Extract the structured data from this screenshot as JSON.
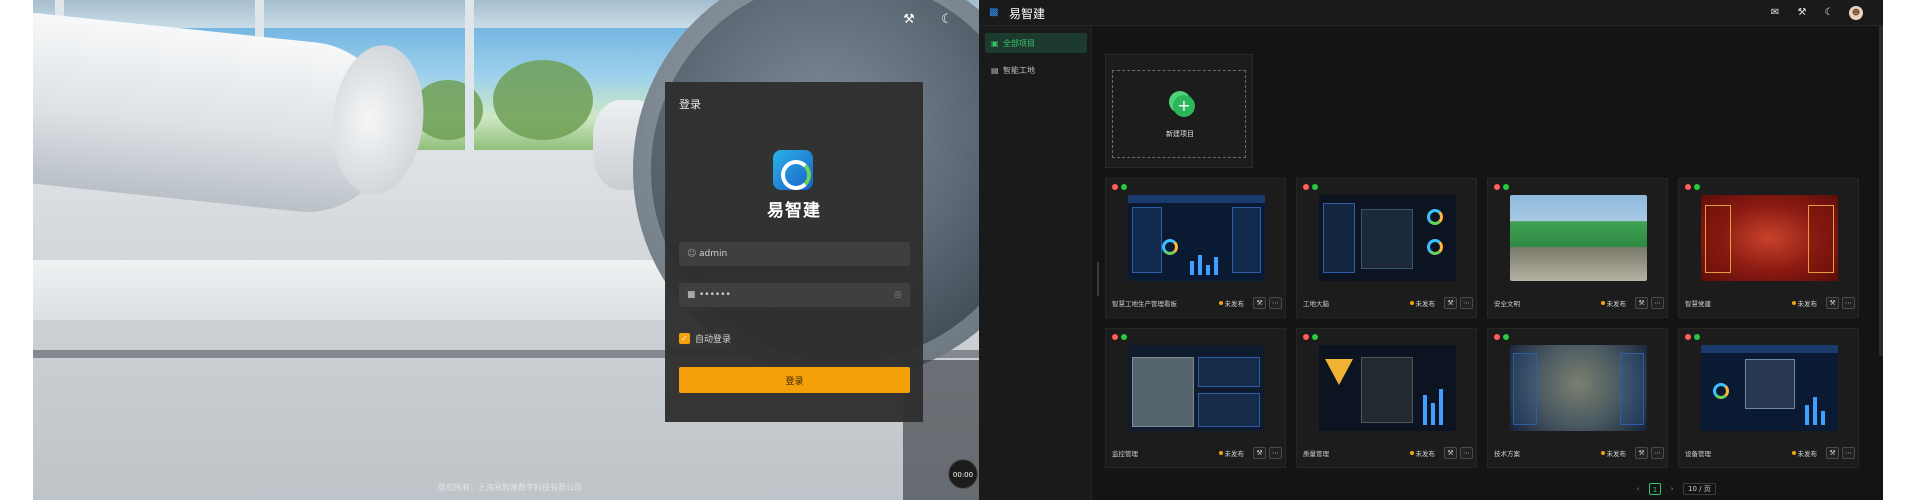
{
  "login": {
    "title": "登录",
    "brand": "易智建",
    "username": {
      "value": "admin",
      "icon": "user-icon"
    },
    "password": {
      "value": "••••••",
      "icon": "lock-icon",
      "toggle_icon": "eye-icon"
    },
    "remember_label": "自动登录",
    "remember_checked": true,
    "submit_label": "登录",
    "top_icons": [
      "tools-icon",
      "moon-icon"
    ],
    "copyright": "版权所有：上海易智建数字科技有限公司",
    "timer": "00:00",
    "accent": "#f5a00b"
  },
  "app": {
    "brand": "易智建",
    "header_icons": [
      "chat-icon",
      "tools-icon",
      "moon-icon",
      "avatar"
    ],
    "sidebar": {
      "items": [
        {
          "label": "全部项目",
          "icon": "monitor-icon",
          "active": true
        },
        {
          "label": "智能工地",
          "icon": "server-icon",
          "active": false
        }
      ]
    },
    "new_project_label": "新建项目",
    "projects": [
      {
        "name": "智慧工地生产管理看板",
        "status": "未发布",
        "thumb": "t-dash"
      },
      {
        "name": "工地大脑",
        "status": "未发布",
        "thumb": "t-dark"
      },
      {
        "name": "安全文明",
        "status": "未发布",
        "thumb": "t-site"
      },
      {
        "name": "智慧党建",
        "status": "未发布",
        "thumb": "t-red"
      },
      {
        "name": "监控管理",
        "status": "未发布",
        "thumb": "t-cams"
      },
      {
        "name": "质量管理",
        "status": "未发布",
        "thumb": "t-dark"
      },
      {
        "name": "技术方案",
        "status": "未发布",
        "thumb": "t-city"
      },
      {
        "name": "设备管理",
        "status": "未发布",
        "thumb": "t-dash"
      }
    ],
    "pagination": {
      "current": "1",
      "page_size": "10 / 页"
    },
    "accent": "#36c76f"
  }
}
